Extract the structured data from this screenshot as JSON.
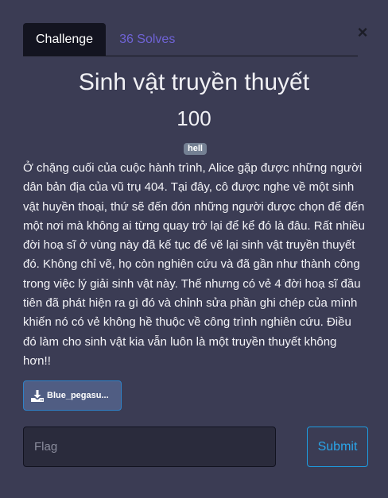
{
  "tabs": {
    "challenge": "Challenge",
    "solves": "36 Solves"
  },
  "close_glyph": "×",
  "challenge": {
    "title": "Sinh vật truyền thuyết",
    "points": "100",
    "tag": "hell",
    "description": "Ở chặng cuối của cuộc hành trình, Alice gặp được những người dân bản địa của vũ trụ 404. Tại đây, cô được nghe về một sinh vật huyền thoại, thứ sẽ đến đón những người được chọn để đến một nơi mà không ai từng quay trở lại để kể đó là đâu. Rất nhiều đời hoạ sĩ ở vùng này đã kế tục để vẽ lại sinh vật truyền thuyết đó. Không chỉ vẽ, họ còn nghiên cứu và đã gần như thành công trong việc lý giải sinh vật này. Thế nhưng có vẻ 4 đời hoạ sĩ đầu tiên đã phát hiện ra gì đó và chỉnh sửa phần ghi chép của mình khiến nó có vẻ không hề thuộc về công trình nghiên cứu. Điều đó làm cho sinh vật kia vẫn luôn là một truyền thuyết không hơn!!",
    "file_label": "Blue_pegasu..."
  },
  "form": {
    "flag_placeholder": "Flag",
    "submit_label": "Submit"
  },
  "icons": {
    "download": "download-icon",
    "close": "close-icon"
  },
  "colors": {
    "background": "#3b3c54",
    "active_tab": "#131420",
    "solves_link": "#6f63d6",
    "submit_accent": "#1d9ce0",
    "tag_bg": "#748093"
  }
}
